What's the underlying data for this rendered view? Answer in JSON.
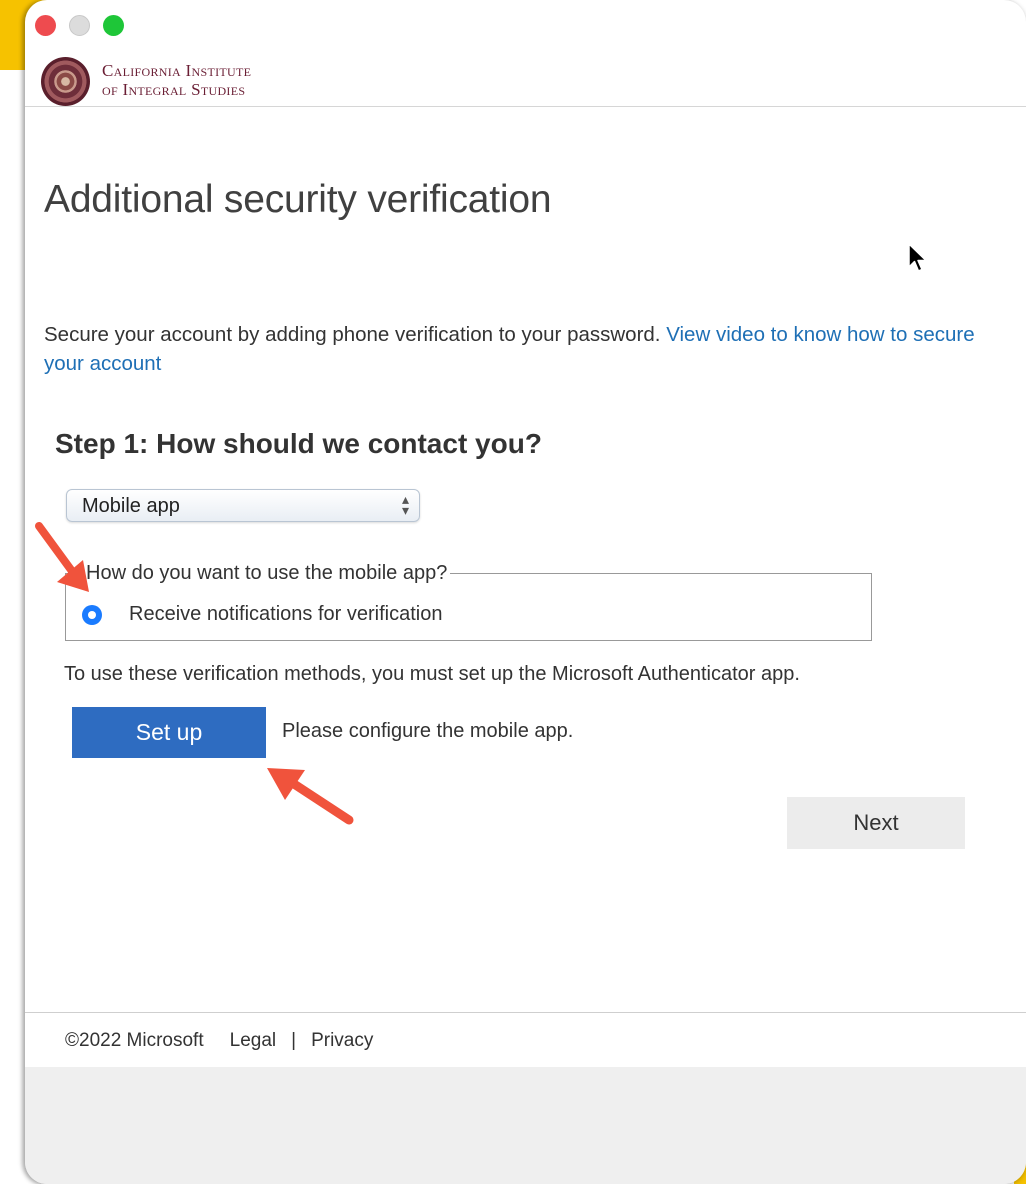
{
  "branding": {
    "line1": "California Institute",
    "line2": "of Integral Studies"
  },
  "page": {
    "title": "Additional security verification",
    "intro_text": "Secure your account by adding phone verification to your password. ",
    "intro_link": "View video to know how to secure your account"
  },
  "step1": {
    "heading": "Step 1: How should we contact you?",
    "method_select_value": "Mobile app",
    "mobile_app_legend": "How do you want to use the mobile app?",
    "radio_option_label": "Receive notifications for verification",
    "radio_option_selected": true,
    "authenticator_note": "To use these verification methods, you must set up the Microsoft Authenticator app.",
    "setup_button_label": "Set up",
    "setup_message": "Please configure the mobile app."
  },
  "actions": {
    "next_label": "Next"
  },
  "footer": {
    "copyright": "©2022 Microsoft",
    "legal": "Legal",
    "separator": "|",
    "privacy": "Privacy"
  },
  "colors": {
    "primary_button": "#2e6cc1",
    "link": "#1e6fb5",
    "annotation_arrow": "#f0533c",
    "accent_yellow": "#f6c200"
  }
}
